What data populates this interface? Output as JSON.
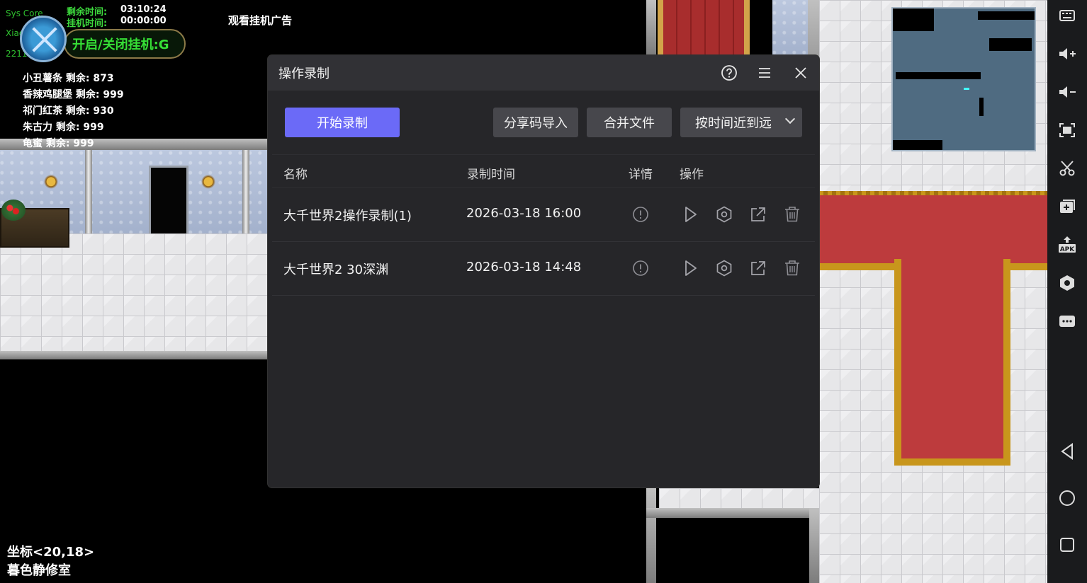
{
  "hud": {
    "sys_lines": [
      "Sys Core",
      "Xiaomi",
      "2211133C"
    ],
    "remaining_time_label": "剩余时间:",
    "remaining_time_value": "03:10:24",
    "hook_time_label": "挂机时间:",
    "hook_time_value": "00:00:00",
    "hook_toggle_label": "开启/关闭挂机:G",
    "ad_label": "观看挂机广告",
    "stocks": [
      "小丑薯条 剩余: 873",
      "香辣鸡腿堡 剩余: 999",
      "祁门红茶 剩余: 930",
      "朱古力 剩余: 999",
      "龟蜜 剩余: 999"
    ],
    "coord": "坐标<20,18>",
    "location": "暮色静修室"
  },
  "dialog": {
    "title": "操作录制",
    "start_button": "开始录制",
    "import_button": "分享码导入",
    "merge_button": "合并文件",
    "sort_select": "按时间近到远",
    "columns": [
      "名称",
      "录制时间",
      "详情",
      "操作"
    ],
    "rows": [
      {
        "name": "大千世界2操作录制(1)",
        "time": "2026-03-18 16:00"
      },
      {
        "name": "大千世界2 30深渊",
        "time": "2026-03-18 14:48"
      }
    ]
  },
  "colors": {
    "primary": "#6b6af7",
    "dialog_bg": "#262629",
    "header_bg": "#313135",
    "secondary_btn": "#47474c",
    "hud_green": "#36e036",
    "carpet_red": "#bd3b3d",
    "carpet_gold": "#c8961c"
  },
  "icons": {
    "sidebar": [
      "keyboard-icon",
      "volume-up-icon",
      "volume-down-icon",
      "screenshot-icon",
      "scissors-icon",
      "add-window-icon",
      "apk-install-icon",
      "settings-icon",
      "more-icon",
      "back-icon",
      "home-icon",
      "recents-icon"
    ],
    "dialog_header": [
      "help-icon",
      "menu-icon",
      "close-icon"
    ],
    "row_actions": [
      "detail-icon",
      "play-icon",
      "settings-icon",
      "export-icon",
      "delete-icon"
    ]
  }
}
